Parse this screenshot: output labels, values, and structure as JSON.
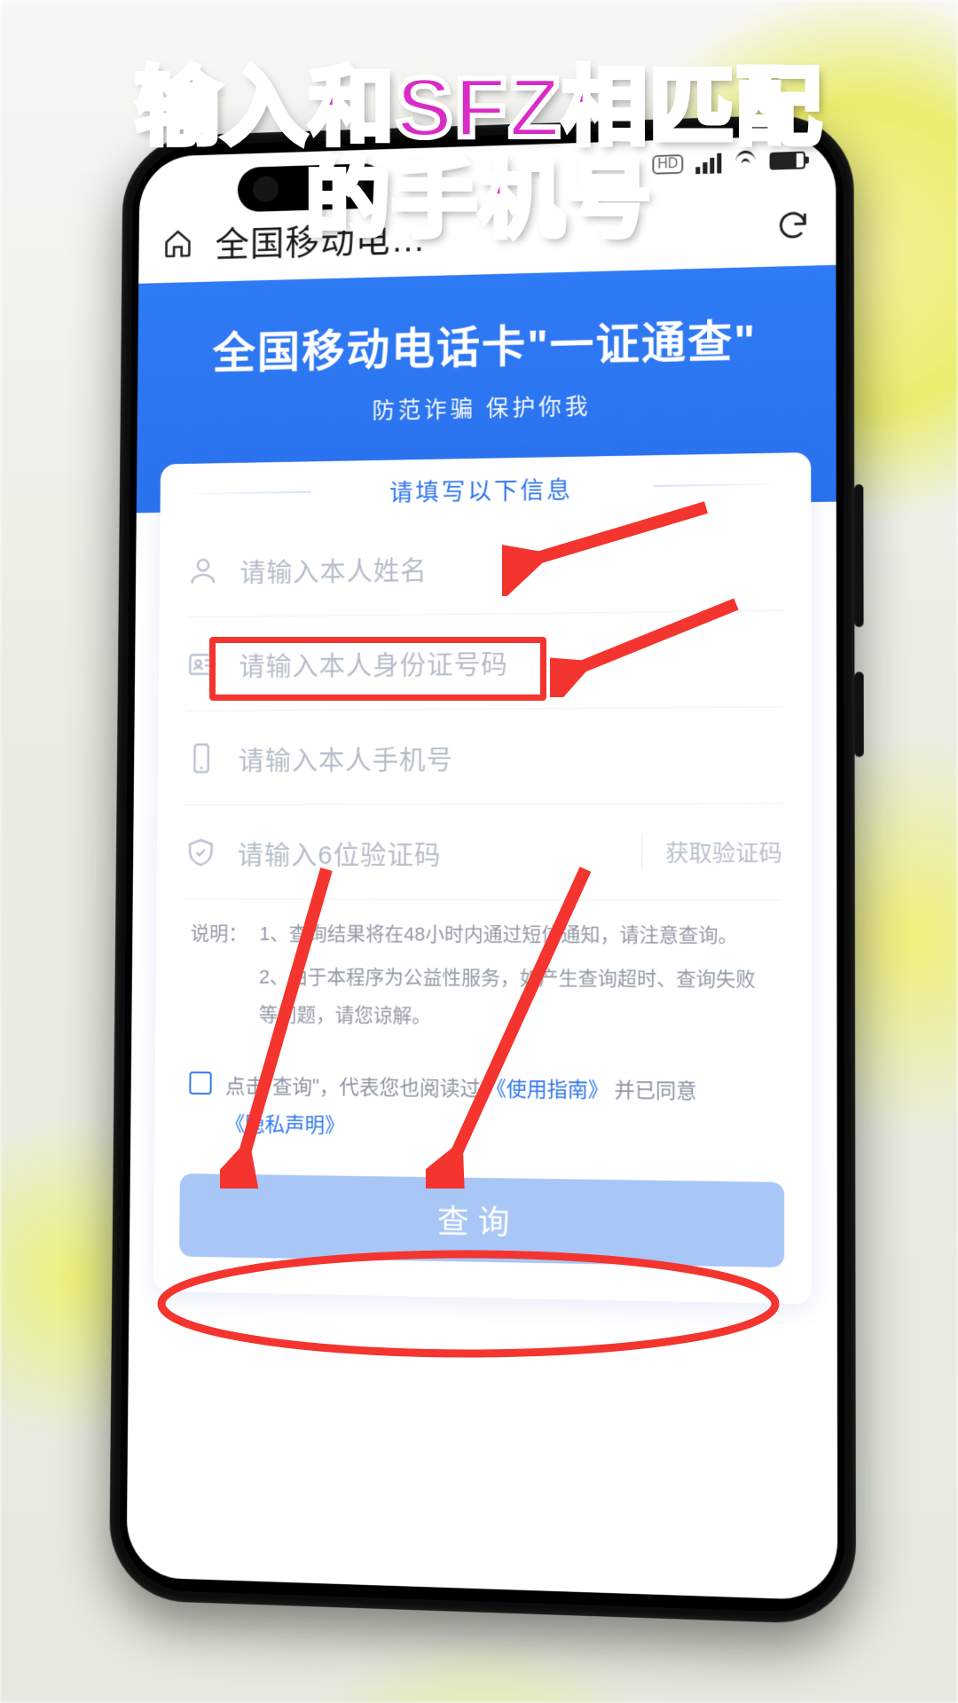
{
  "caption": {
    "line1": "输入和SFZ相匹配",
    "line2": "的手机号"
  },
  "browser": {
    "title": "全国移动电…",
    "hd": "HD"
  },
  "banner": {
    "title": "全国移动电话卡\"一证通查\"",
    "subtitle": "防范诈骗 保护你我"
  },
  "card": {
    "tab": "请填写以下信息",
    "fields": {
      "name_ph": "请输入本人姓名",
      "id_ph": "请输入本人身份证号码",
      "phone_ph": "请输入本人手机号",
      "code_ph": "请输入6位验证码",
      "getcode": "获取验证码"
    },
    "notes": {
      "label": "说明：",
      "n1_pre": "1、",
      "n1": "查询结果将在48小时内通过短信通知，请注意查询。",
      "n2_pre": "2、",
      "n2": "由于本程序为公益性服务，如产生查询超时、查询失败等问题，请您谅解。"
    },
    "agree": {
      "pre": "点击\"查询\"，代表您也阅读过 ",
      "guide": "《使用指南》",
      "mid": " 并已同意",
      "privacy": "《隐私声明》"
    },
    "query_btn": "查询"
  }
}
